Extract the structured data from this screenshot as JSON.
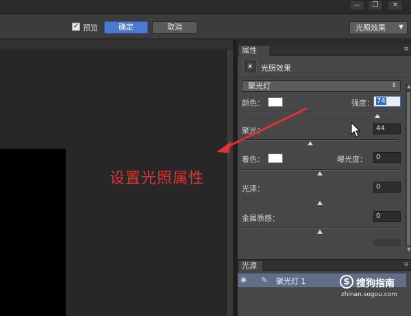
{
  "window_controls": [
    "—",
    "❐",
    "✕"
  ],
  "options_bar": {
    "preview_label": "预览",
    "preview_checked": true,
    "ok_label": "确定",
    "cancel_label": "取消",
    "preset_value": "光照效果"
  },
  "properties": {
    "tab_label": "属性",
    "title": "光照效果",
    "light_type": "聚光灯",
    "color_label": "颜色：",
    "intensity_label": "强度：",
    "intensity_value": "74",
    "hotspot_label": "聚光：",
    "hotspot_value": "44",
    "colorize_label": "着色：",
    "exposure_label": "曝光度：",
    "exposure_value": "0",
    "gloss_label": "光泽：",
    "gloss_value": "0",
    "metallic_label": "金属质感：",
    "metallic_value": "0",
    "sliders": {
      "intensity": 0.87,
      "hotspot": 0.44,
      "exposure": 0.5,
      "gloss": 0.5,
      "metallic": 0.5
    }
  },
  "lights_panel": {
    "tab_label": "光源",
    "items": [
      {
        "name": "聚光灯 1",
        "visible": true
      }
    ]
  },
  "annotation_text": "设置光照属性",
  "watermark": {
    "brand": "搜狗指南",
    "url": "zhinan.sogou.com"
  },
  "colors": {
    "accent": "#4a7bd0",
    "annotation": "#e03232",
    "panel": "#474747"
  }
}
